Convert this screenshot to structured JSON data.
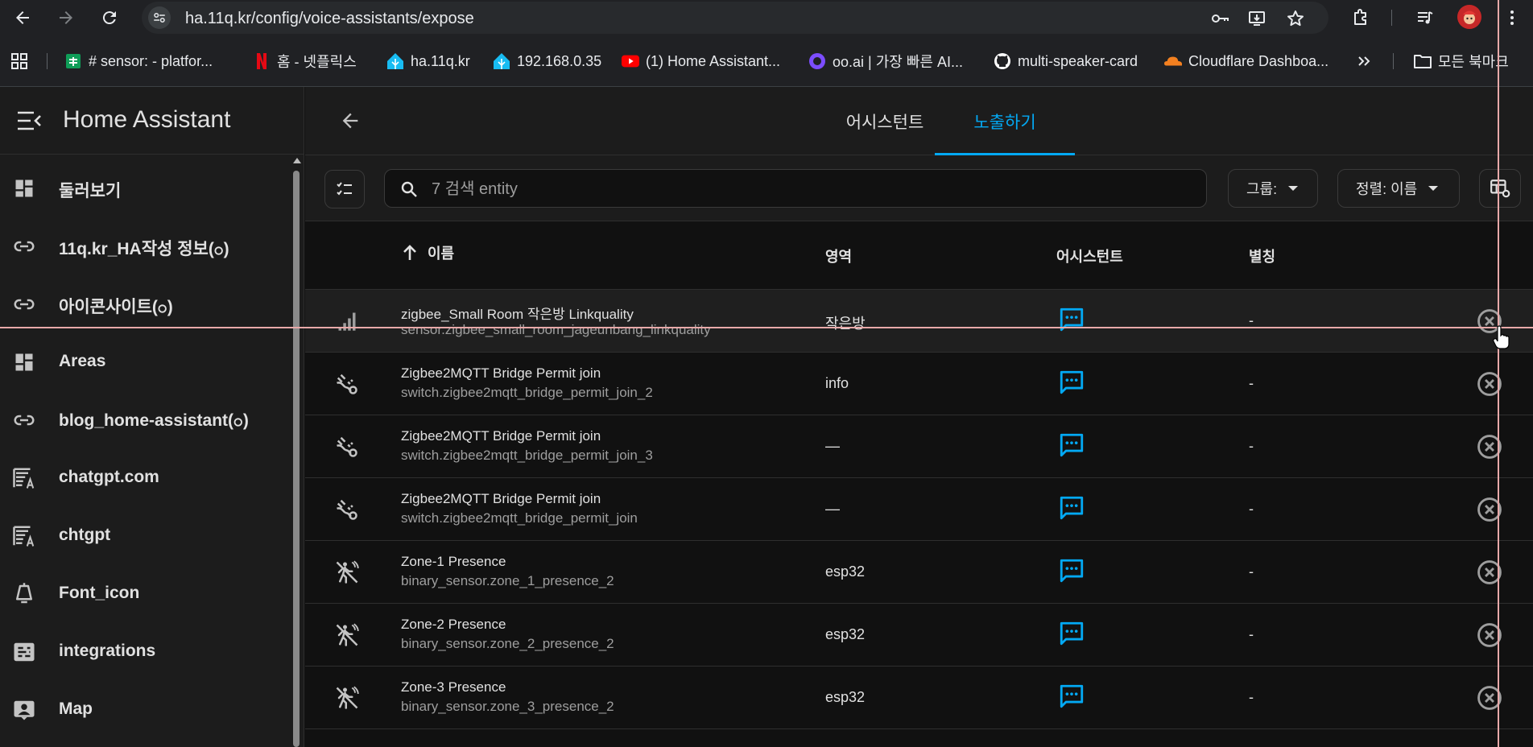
{
  "browser": {
    "url": "ha.11q.kr/config/voice-assistants/expose",
    "bookmarks": [
      {
        "label": "# sensor:    - platfor...",
        "icon": "sheets-icon",
        "color": "#0f9d58"
      },
      {
        "label": "홈 - 넷플릭스",
        "icon": "netflix-icon",
        "color": "#e50914"
      },
      {
        "label": "ha.11q.kr",
        "icon": "home-assistant-icon",
        "color": "#18bcf2"
      },
      {
        "label": "192.168.0.35",
        "icon": "home-assistant-icon",
        "color": "#18bcf2"
      },
      {
        "label": "(1) Home Assistant...",
        "icon": "youtube-icon",
        "color": "#ff0000"
      },
      {
        "label": "oo.ai | 가장 빠른 AI...",
        "icon": "oo-ai-icon",
        "color": "#7c4dff"
      },
      {
        "label": "multi-speaker-card",
        "icon": "github-icon",
        "color": "#ffffff"
      },
      {
        "label": "Cloudflare Dashboa...",
        "icon": "cloudflare-icon",
        "color": "#f38020"
      }
    ],
    "all_bookmarks_label": "모든 북마크"
  },
  "sidebar": {
    "title": "Home Assistant",
    "items": [
      {
        "label": "둘러보기",
        "icon": "dashboard-icon"
      },
      {
        "label": "11q.kr_HA작성 정보(ဝ)",
        "icon": "link-icon"
      },
      {
        "label": "아이콘사이트(ဝ)",
        "icon": "link-icon"
      },
      {
        "label": "Areas",
        "icon": "dashboard-icon"
      },
      {
        "label": "blog_home-assistant(ဝ)",
        "icon": "link-icon"
      },
      {
        "label": "chatgpt.com",
        "icon": "text-box-icon"
      },
      {
        "label": "chtgpt",
        "icon": "text-box-icon"
      },
      {
        "label": "Font_icon",
        "icon": "lamp-icon"
      },
      {
        "label": "integrations",
        "icon": "integrations-icon"
      },
      {
        "label": "Map",
        "icon": "account-box-icon"
      }
    ]
  },
  "main": {
    "tabs": [
      {
        "label": "어시스턴트",
        "active": false
      },
      {
        "label": "노출하기",
        "active": true
      }
    ],
    "search_placeholder": "7 검색 entity",
    "group_label": "그룹:",
    "sort_label": "정렬: 이름",
    "columns": {
      "name": "이름",
      "area": "영역",
      "assistant": "어시스턴트",
      "alias": "별칭"
    },
    "accent_color": "#03a9f4",
    "rows": [
      {
        "name": "zigbee_Small Room 작은방 Linkquality",
        "entity": "sensor.zigbee_small_room_jageunbang_linkquality",
        "area": "작은방",
        "alias": "-",
        "icon": "signal-icon",
        "hover": true
      },
      {
        "name": "Zigbee2MQTT Bridge Permit join",
        "entity": "switch.zigbee2mqtt_bridge_permit_join_2",
        "area": "info",
        "alias": "-",
        "icon": "zigbee-icon",
        "hover": false
      },
      {
        "name": "Zigbee2MQTT Bridge Permit join",
        "entity": "switch.zigbee2mqtt_bridge_permit_join_3",
        "area": "—",
        "alias": "-",
        "icon": "zigbee-icon",
        "hover": false
      },
      {
        "name": "Zigbee2MQTT Bridge Permit join",
        "entity": "switch.zigbee2mqtt_bridge_permit_join",
        "area": "—",
        "alias": "-",
        "icon": "zigbee-icon",
        "hover": false
      },
      {
        "name": "Zone-1 Presence",
        "entity": "binary_sensor.zone_1_presence_2",
        "area": "esp32",
        "alias": "-",
        "icon": "motion-sensor-off-icon",
        "hover": false
      },
      {
        "name": "Zone-2 Presence",
        "entity": "binary_sensor.zone_2_presence_2",
        "area": "esp32",
        "alias": "-",
        "icon": "motion-sensor-off-icon",
        "hover": false
      },
      {
        "name": "Zone-3 Presence",
        "entity": "binary_sensor.zone_3_presence_2",
        "area": "esp32",
        "alias": "-",
        "icon": "motion-sensor-off-icon",
        "hover": false
      }
    ]
  }
}
